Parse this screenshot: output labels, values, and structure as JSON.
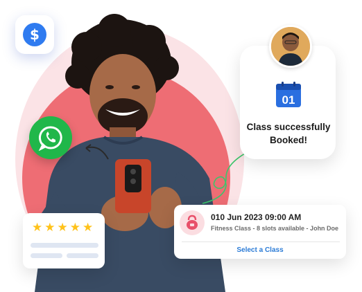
{
  "booking_card": {
    "date_label": "01",
    "line1": "Class successfully",
    "line2": "Booked!"
  },
  "slot_card": {
    "datetime": "010 Jun 2023 09:00 AM",
    "description": "Fitness Class - 8 slots available - John Doe",
    "action_label": "Select a Class"
  },
  "rating": {
    "stars": 5,
    "star_glyph": "★"
  },
  "icons": {
    "dollar": "dollar-icon",
    "whatsapp": "whatsapp-icon",
    "calendar": "calendar-icon",
    "kettlebell": "kettlebell-icon"
  },
  "dollar_symbol": "$",
  "colors": {
    "accent_blue": "#2f7bf0",
    "whatsapp_green": "#20b74a",
    "link_blue": "#2b7bd6",
    "star_yellow": "#ffc21a",
    "bg_pink": "#ee6d74"
  }
}
